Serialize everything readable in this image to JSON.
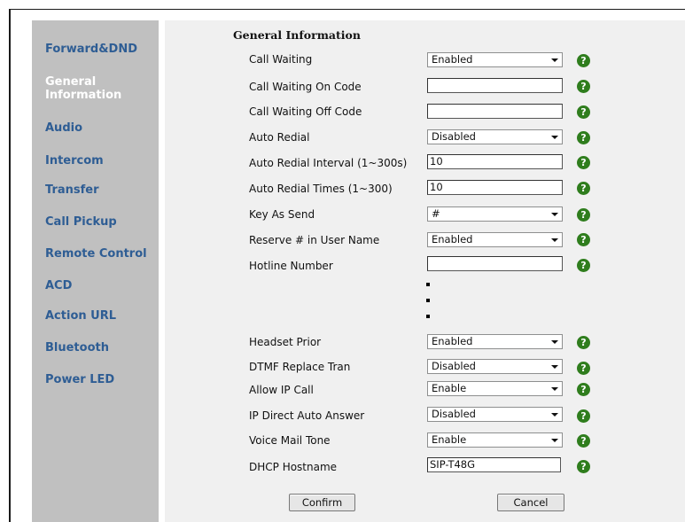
{
  "sidebar": {
    "items": [
      {
        "label": "Forward&DND"
      },
      {
        "label": "General\nInformation"
      },
      {
        "label": "Audio"
      },
      {
        "label": "Intercom"
      },
      {
        "label": "Transfer"
      },
      {
        "label": "Call Pickup"
      },
      {
        "label": "Remote Control"
      },
      {
        "label": "ACD"
      },
      {
        "label": "Action URL"
      },
      {
        "label": "Bluetooth"
      },
      {
        "label": "Power LED"
      }
    ],
    "active_color": "#ffffff",
    "item_color": "#2e5d94",
    "background": "#c0c0c0"
  },
  "main": {
    "section_title": "General Information",
    "fields": [
      {
        "label": "Call Waiting",
        "type": "select",
        "value": "Enabled"
      },
      {
        "label": "Call Waiting On Code",
        "type": "input",
        "value": ""
      },
      {
        "label": "Call Waiting Off Code",
        "type": "input",
        "value": ""
      },
      {
        "label": "Auto Redial",
        "type": "select",
        "value": "Disabled"
      },
      {
        "label": "Auto Redial Interval (1~300s)",
        "type": "input",
        "value": "10"
      },
      {
        "label": "Auto Redial Times (1~300)",
        "type": "input",
        "value": "10"
      },
      {
        "label": "Key As Send",
        "type": "select",
        "value": "#"
      },
      {
        "label": "Reserve # in User Name",
        "type": "select",
        "value": "Enabled"
      },
      {
        "label": "Hotline Number",
        "type": "input",
        "value": ""
      },
      {
        "label": "Headset Prior",
        "type": "select",
        "value": "Enabled"
      },
      {
        "label": "DTMF Replace Tran",
        "type": "select",
        "value": "Disabled"
      },
      {
        "label": "Allow IP Call",
        "type": "select",
        "value": "Enable"
      },
      {
        "label": "IP Direct Auto Answer",
        "type": "select",
        "value": "Disabled"
      },
      {
        "label": "Voice Mail Tone",
        "type": "select",
        "value": "Enable"
      },
      {
        "label": "DHCP Hostname",
        "type": "input",
        "value": "SIP-T48G"
      }
    ],
    "help_icon": "question-mark-icon",
    "help_color": "#2f7d1d",
    "help_glyph": "?"
  },
  "footer": {
    "confirm_label": "Confirm",
    "cancel_label": "Cancel"
  }
}
